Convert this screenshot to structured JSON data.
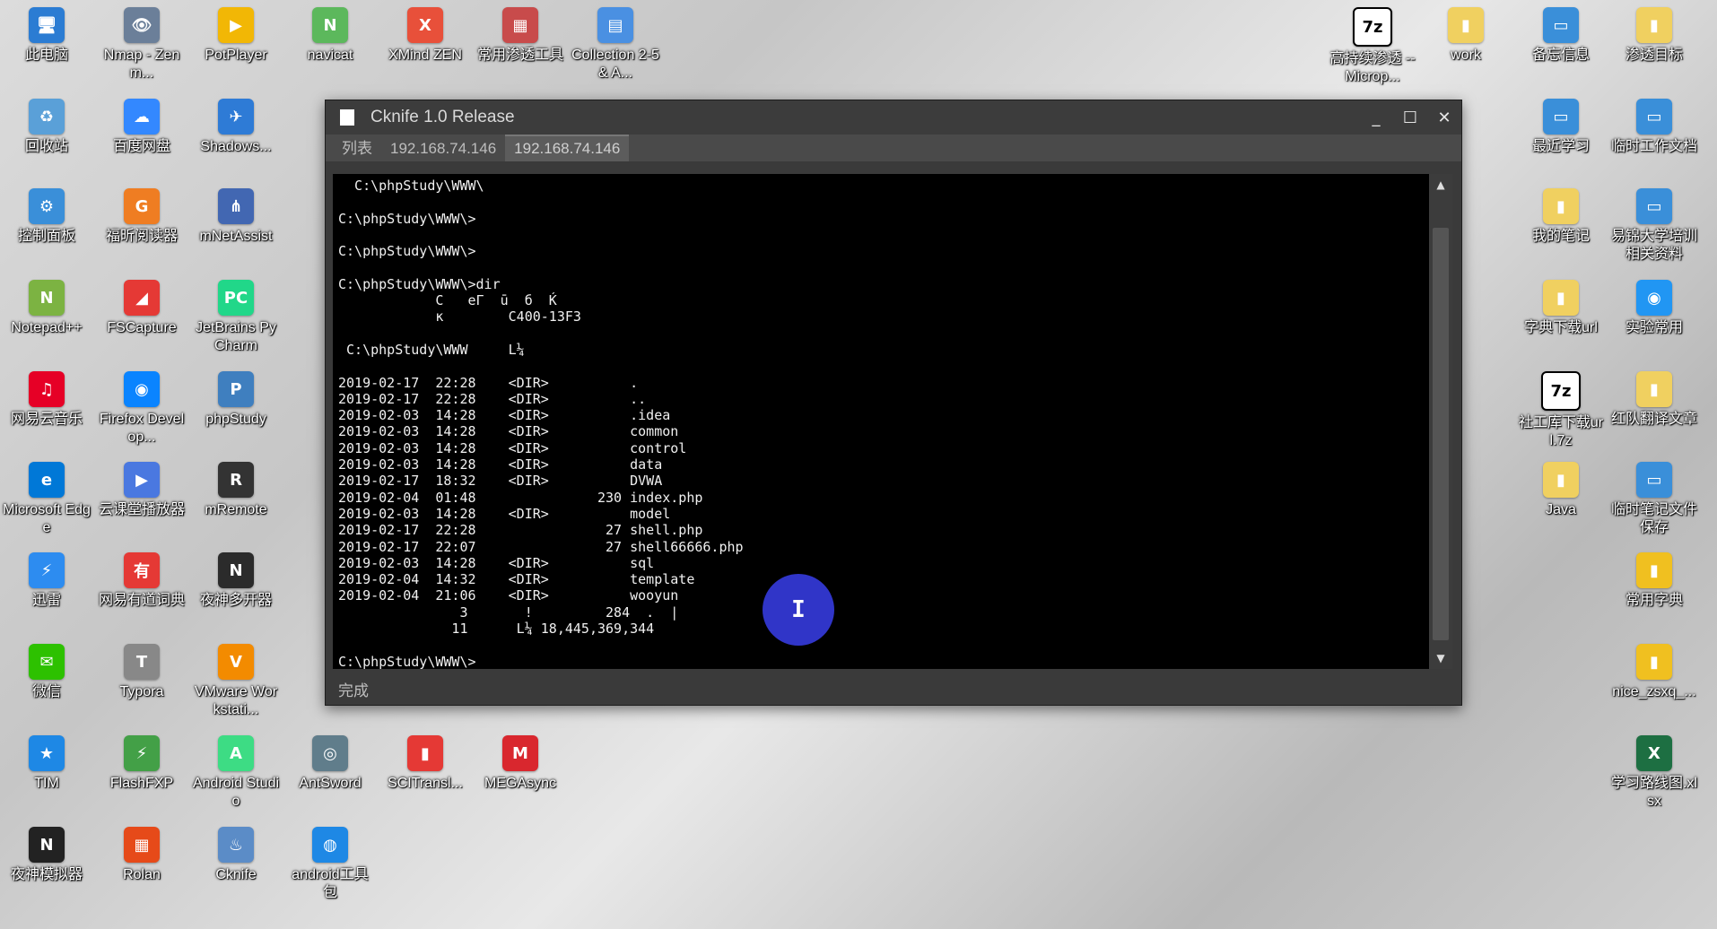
{
  "desktop": {
    "icons": [
      {
        "label": "此电脑",
        "glyph": "🖥",
        "color": "#2b7cd3"
      },
      {
        "label": "Nmap - Zenm...",
        "glyph": "👁",
        "color": "#6b7f99"
      },
      {
        "label": "PotPlayer",
        "glyph": "▶",
        "color": "#f2b705"
      },
      {
        "label": "navicat",
        "glyph": "N",
        "color": "#5cb85c"
      },
      {
        "label": "XMind ZEN",
        "glyph": "X",
        "color": "#e8503a"
      },
      {
        "label": "常用渗透工具",
        "glyph": "▦",
        "color": "#c84b4b"
      },
      {
        "label": "Collection 2-5 & A...",
        "glyph": "▤",
        "color": "#4a90e2"
      },
      {
        "label": "回收站",
        "glyph": "♻",
        "color": "#5aa0d8"
      },
      {
        "label": "百度网盘",
        "glyph": "☁",
        "color": "#3388ff"
      },
      {
        "label": "Shadows...",
        "glyph": "✈",
        "color": "#2e7bd6"
      },
      {
        "label": "控制面板",
        "glyph": "⚙",
        "color": "#3a8fd9"
      },
      {
        "label": "福昕阅读器",
        "glyph": "G",
        "color": "#ef7d22"
      },
      {
        "label": "mNetAssist",
        "glyph": "⋔",
        "color": "#4267b2"
      },
      {
        "label": "Notepad++",
        "glyph": "N",
        "color": "#7cb342"
      },
      {
        "label": "FSCapture",
        "glyph": "◢",
        "color": "#e53935"
      },
      {
        "label": "JetBrains PyCharm",
        "glyph": "PC",
        "color": "#21d789"
      },
      {
        "label": "网易云音乐",
        "glyph": "♫",
        "color": "#e60026"
      },
      {
        "label": "Firefox Develop...",
        "glyph": "◉",
        "color": "#0a84ff"
      },
      {
        "label": "phpStudy",
        "glyph": "P",
        "color": "#3f7fbf"
      },
      {
        "label": "Microsoft Edge",
        "glyph": "e",
        "color": "#0078d7"
      },
      {
        "label": "云课堂播放器",
        "glyph": "▶",
        "color": "#4a78e0"
      },
      {
        "label": "mRemote",
        "glyph": "R",
        "color": "#333333"
      },
      {
        "label": "迅雷",
        "glyph": "⚡",
        "color": "#2d8cf0"
      },
      {
        "label": "网易有道词典",
        "glyph": "有",
        "color": "#e53935"
      },
      {
        "label": "夜神多开器",
        "glyph": "N",
        "color": "#2b2b2b"
      },
      {
        "label": "微信",
        "glyph": "✉",
        "color": "#2dc100"
      },
      {
        "label": "Typora",
        "glyph": "T",
        "color": "#888888"
      },
      {
        "label": "VMware Workstati...",
        "glyph": "V",
        "color": "#f38b00"
      },
      {
        "label": "TIM",
        "glyph": "★",
        "color": "#1e88e5"
      },
      {
        "label": "FlashFXP",
        "glyph": "⚡",
        "color": "#43a047"
      },
      {
        "label": "Android Studio",
        "glyph": "A",
        "color": "#3ddc84"
      },
      {
        "label": "AntSword",
        "glyph": "◎",
        "color": "#607d8b"
      },
      {
        "label": "SCITransl...",
        "glyph": "▮",
        "color": "#e53935"
      },
      {
        "label": "MEGAsync",
        "glyph": "M",
        "color": "#d9272e"
      },
      {
        "label": "夜神模拟器",
        "glyph": "N",
        "color": "#222222"
      },
      {
        "label": "Rolan",
        "glyph": "▦",
        "color": "#e64a19"
      },
      {
        "label": "Cknife",
        "glyph": "♨",
        "color": "#5b8cc7"
      },
      {
        "label": "android工具包",
        "glyph": "◍",
        "color": "#1e88e5"
      },
      {
        "label": "高持续渗透 --Microp...",
        "glyph": "7z",
        "color": "#ffffff"
      },
      {
        "label": "work",
        "glyph": "▮",
        "color": "#f0d060"
      },
      {
        "label": "备忘信息",
        "glyph": "▭",
        "color": "#3a8fd9"
      },
      {
        "label": "渗透目标",
        "glyph": "▮",
        "color": "#f0d060"
      },
      {
        "label": "最近学习",
        "glyph": "▭",
        "color": "#3a8fd9"
      },
      {
        "label": "临时工作文档",
        "glyph": "▭",
        "color": "#3a8fd9"
      },
      {
        "label": "我的笔记",
        "glyph": "▮",
        "color": "#f0d060"
      },
      {
        "label": "易锦大学培训相关资料",
        "glyph": "▭",
        "color": "#3a8fd9"
      },
      {
        "label": "字典下载url",
        "glyph": "▮",
        "color": "#f0d060"
      },
      {
        "label": "实验常用",
        "glyph": "◉",
        "color": "#2196f3"
      },
      {
        "label": "社工库下载url.7z",
        "glyph": "7z",
        "color": "#ffffff"
      },
      {
        "label": "红队翻译文章",
        "glyph": "▮",
        "color": "#f0d060"
      },
      {
        "label": "Java",
        "glyph": "▮",
        "color": "#f0d060"
      },
      {
        "label": "临时笔记文件保存",
        "glyph": "▭",
        "color": "#3a8fd9"
      },
      {
        "label": "常用字典",
        "glyph": "▮",
        "color": "#f0c020"
      },
      {
        "label": "nice_zsxq_...",
        "glyph": "▮",
        "color": "#f0c020"
      },
      {
        "label": "学习路线图.xlsx",
        "glyph": "X",
        "color": "#1d6f42"
      }
    ]
  },
  "window": {
    "title": "Cknife 1.0 Release",
    "minimize": "_",
    "maximize": "☐",
    "close": "✕",
    "tabs": [
      "列表",
      "192.168.74.146",
      "192.168.74.146"
    ],
    "console_lines": [
      "  C:\\phpStudy\\WWW\\",
      "",
      "C:\\phpStudy\\WWW\\>",
      "",
      "C:\\phpStudy\\WWW\\>",
      "",
      "C:\\phpStudy\\WWW\\>dir",
      "            C   eΓ  ū  б  Ќ",
      "            к        C400-13F3",
      "",
      " C:\\phpStudy\\WWW     L¼",
      "",
      "2019-02-17  22:28    <DIR>          .",
      "2019-02-17  22:28    <DIR>          ..",
      "2019-02-03  14:28    <DIR>          .idea",
      "2019-02-03  14:28    <DIR>          common",
      "2019-02-03  14:28    <DIR>          control",
      "2019-02-03  14:28    <DIR>          data",
      "2019-02-17  18:32    <DIR>          DVWA",
      "2019-02-04  01:48               230 index.php",
      "2019-02-03  14:28    <DIR>          model",
      "2019-02-17  22:28                27 shell.php",
      "2019-02-17  22:07                27 shell66666.php",
      "2019-02-03  14:28    <DIR>          sql",
      "2019-02-04  14:32    <DIR>          template",
      "2019-02-04  21:06    <DIR>          wooyun",
      "               3       !         284  .  |",
      "              11      L¼ 18,445,369,344",
      "",
      "C:\\phpStudy\\WWW\\>"
    ],
    "status": "完成"
  }
}
